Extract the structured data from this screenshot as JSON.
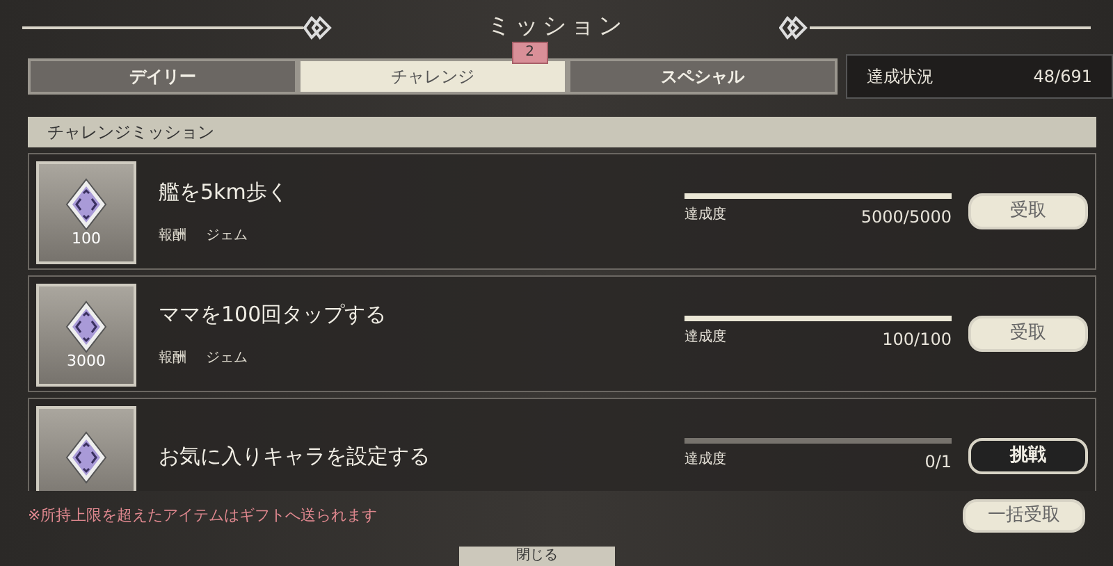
{
  "title": "ミッション",
  "tabs": [
    {
      "label": "デイリー",
      "selected": false
    },
    {
      "label": "チャレンジ",
      "selected": true,
      "badge": "2"
    },
    {
      "label": "スペシャル",
      "selected": false
    }
  ],
  "progress_summary": {
    "label": "達成状況",
    "value": "48/691"
  },
  "section_title": "チャレンジミッション",
  "missions": [
    {
      "title": "艦を5km歩く",
      "reward_count": "100",
      "reward_label": "報酬",
      "reward_name": "ジェム",
      "progress_label": "達成度",
      "progress_text": "5000/5000",
      "level": 1,
      "button": {
        "label": "受取",
        "kind": "claim"
      }
    },
    {
      "title": "ママを100回タップする",
      "reward_count": "3000",
      "reward_label": "報酬",
      "reward_name": "ジェム",
      "progress_label": "達成度",
      "progress_text": "100/100",
      "level": 1,
      "button": {
        "label": "受取",
        "kind": "claim"
      }
    },
    {
      "title": "お気に入りキャラを設定する",
      "progress_label": "達成度",
      "progress_text": "0/1",
      "level": 0,
      "button": {
        "label": "挑戦",
        "kind": "challenge"
      }
    }
  ],
  "notice": "※所持上限を超えたアイテムはギフトへ送られます",
  "claim_all_button": "一括受取",
  "close_button": "閉じる"
}
